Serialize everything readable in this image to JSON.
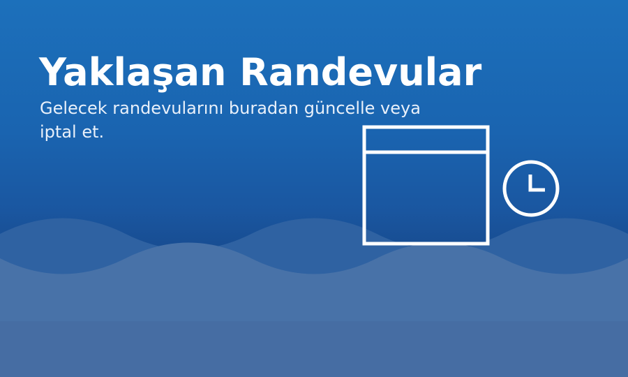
{
  "hero": {
    "title": "Yaklaşan Randevular",
    "subtitle": "Gelecek randevularını buradan güncelle veya iptal et."
  },
  "icons": {
    "calendar": "calendar-icon",
    "clock": "clock-icon"
  },
  "colors": {
    "background_top": "#1c70bb",
    "background_bottom": "#17498c",
    "wave_back": "#3566a4",
    "wave_front": "#4a74a8",
    "icon_stroke": "#ffffff"
  }
}
